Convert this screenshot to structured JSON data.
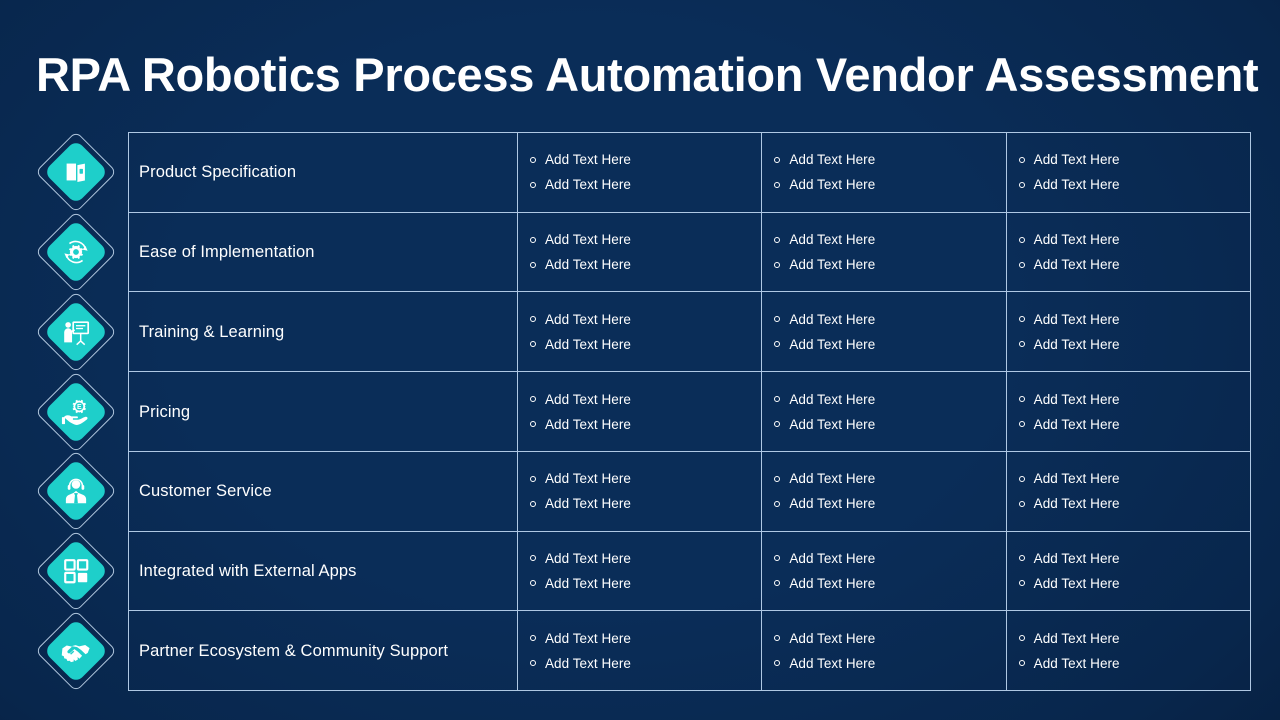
{
  "slide": {
    "title": "RPA Robotics Process Automation Vendor Assessment",
    "colors": {
      "background_dark": "#0a2c57",
      "background_mid": "#0d4b93",
      "background_bright": "#0b5cb0",
      "accent_cyan": "#1ecfca",
      "border": "#bed6f0",
      "text": "#ffffff"
    }
  },
  "bullet_text": "Add Text Here",
  "rows": [
    {
      "icon": "product-box-icon",
      "label": "Product Specification",
      "vendors": [
        {
          "items": [
            "Add Text Here",
            "Add Text Here"
          ]
        },
        {
          "items": [
            "Add Text Here",
            "Add Text Here"
          ]
        },
        {
          "items": [
            "Add Text Here",
            "Add Text Here"
          ]
        }
      ]
    },
    {
      "icon": "gear-refresh-icon",
      "label": "Ease of Implementation",
      "vendors": [
        {
          "items": [
            "Add Text Here",
            "Add Text Here"
          ]
        },
        {
          "items": [
            "Add Text Here",
            "Add Text Here"
          ]
        },
        {
          "items": [
            "Add Text Here",
            "Add Text Here"
          ]
        }
      ]
    },
    {
      "icon": "presenter-whiteboard-icon",
      "label": "Training & Learning",
      "vendors": [
        {
          "items": [
            "Add Text Here",
            "Add Text Here"
          ]
        },
        {
          "items": [
            "Add Text Here",
            "Add Text Here"
          ]
        },
        {
          "items": [
            "Add Text Here",
            "Add Text Here"
          ]
        }
      ]
    },
    {
      "icon": "hand-coin-gear-icon",
      "label": "Pricing",
      "vendors": [
        {
          "items": [
            "Add Text Here",
            "Add Text Here"
          ]
        },
        {
          "items": [
            "Add Text Here",
            "Add Text Here"
          ]
        },
        {
          "items": [
            "Add Text Here",
            "Add Text Here"
          ]
        }
      ]
    },
    {
      "icon": "headset-agent-icon",
      "label": "Customer Service",
      "vendors": [
        {
          "items": [
            "Add Text Here",
            "Add Text Here"
          ]
        },
        {
          "items": [
            "Add Text Here",
            "Add Text Here"
          ]
        },
        {
          "items": [
            "Add Text Here",
            "Add Text Here"
          ]
        }
      ]
    },
    {
      "icon": "app-grid-icon",
      "label": "Integrated with External Apps",
      "vendors": [
        {
          "items": [
            "Add Text Here",
            "Add Text Here"
          ]
        },
        {
          "items": [
            "Add Text Here",
            "Add Text Here"
          ]
        },
        {
          "items": [
            "Add Text Here",
            "Add Text Here"
          ]
        }
      ]
    },
    {
      "icon": "handshake-icon",
      "label": "Partner Ecosystem & Community Support",
      "vendors": [
        {
          "items": [
            "Add Text Here",
            "Add Text Here"
          ]
        },
        {
          "items": [
            "Add Text Here",
            "Add Text Here"
          ]
        },
        {
          "items": [
            "Add Text Here",
            "Add Text Here"
          ]
        }
      ]
    }
  ]
}
